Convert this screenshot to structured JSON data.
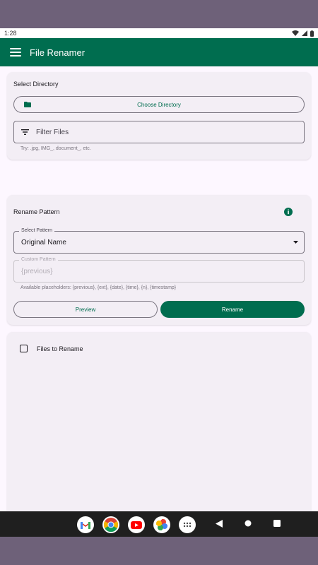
{
  "status_bar": {
    "time": "1:28"
  },
  "app_bar": {
    "title": "File Renamer"
  },
  "select_directory": {
    "title": "Select Directory",
    "choose_button": "Choose Directory",
    "filter_placeholder": "Filter Files",
    "hint": "Try: .jpg, IMG_, document_, etc."
  },
  "rename_pattern": {
    "title": "Rename Pattern",
    "select_label": "Select Pattern",
    "select_value": "Original Name",
    "custom_label": "Custom Pattern",
    "custom_value": "{previous}",
    "placeholders_hint": "Available placeholders: {previous}, {ext}, {date}, {time}, {n}, {timestamp}",
    "preview_button": "Preview",
    "rename_button": "Rename"
  },
  "files": {
    "label": "Files to Rename",
    "select_all_checked": false
  },
  "dock": {
    "apps": [
      "gmail-icon",
      "chrome-icon",
      "youtube-icon",
      "photos-icon",
      "app-drawer-icon"
    ]
  },
  "colors": {
    "primary": "#006d4f",
    "surface": "#fdf7ff",
    "card": "#f3eef5"
  }
}
